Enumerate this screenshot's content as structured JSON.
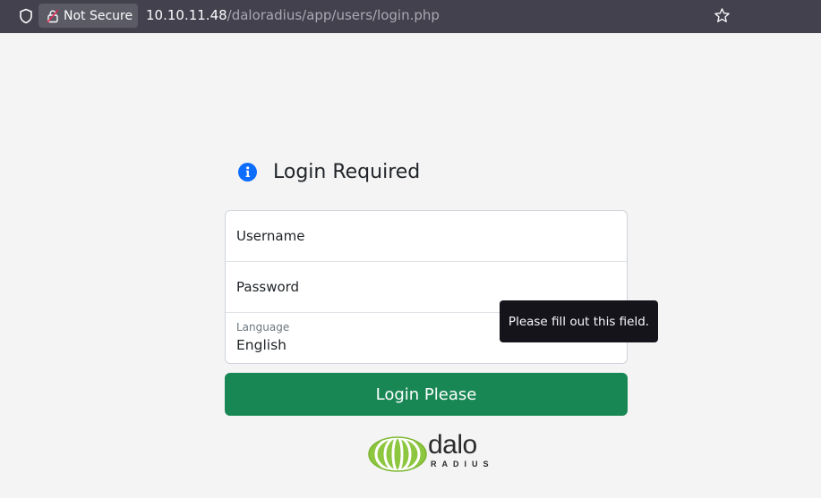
{
  "browser": {
    "security_label": "Not Secure",
    "url_host": "10.10.11.48",
    "url_path": "/daloradius/app/users/login.php"
  },
  "login": {
    "heading": "Login Required",
    "username_placeholder": "Username",
    "password_placeholder": "Password",
    "language_label": "Language",
    "language_value": "English",
    "submit_label": "Login Please"
  },
  "tooltip": {
    "text": "Please fill out this field."
  },
  "logo": {
    "wordmark": "dalo",
    "submark": "RADIUS"
  },
  "colors": {
    "primary_button": "#198754",
    "info_icon": "#0d6efd",
    "logo_green": "#8dc63f"
  }
}
